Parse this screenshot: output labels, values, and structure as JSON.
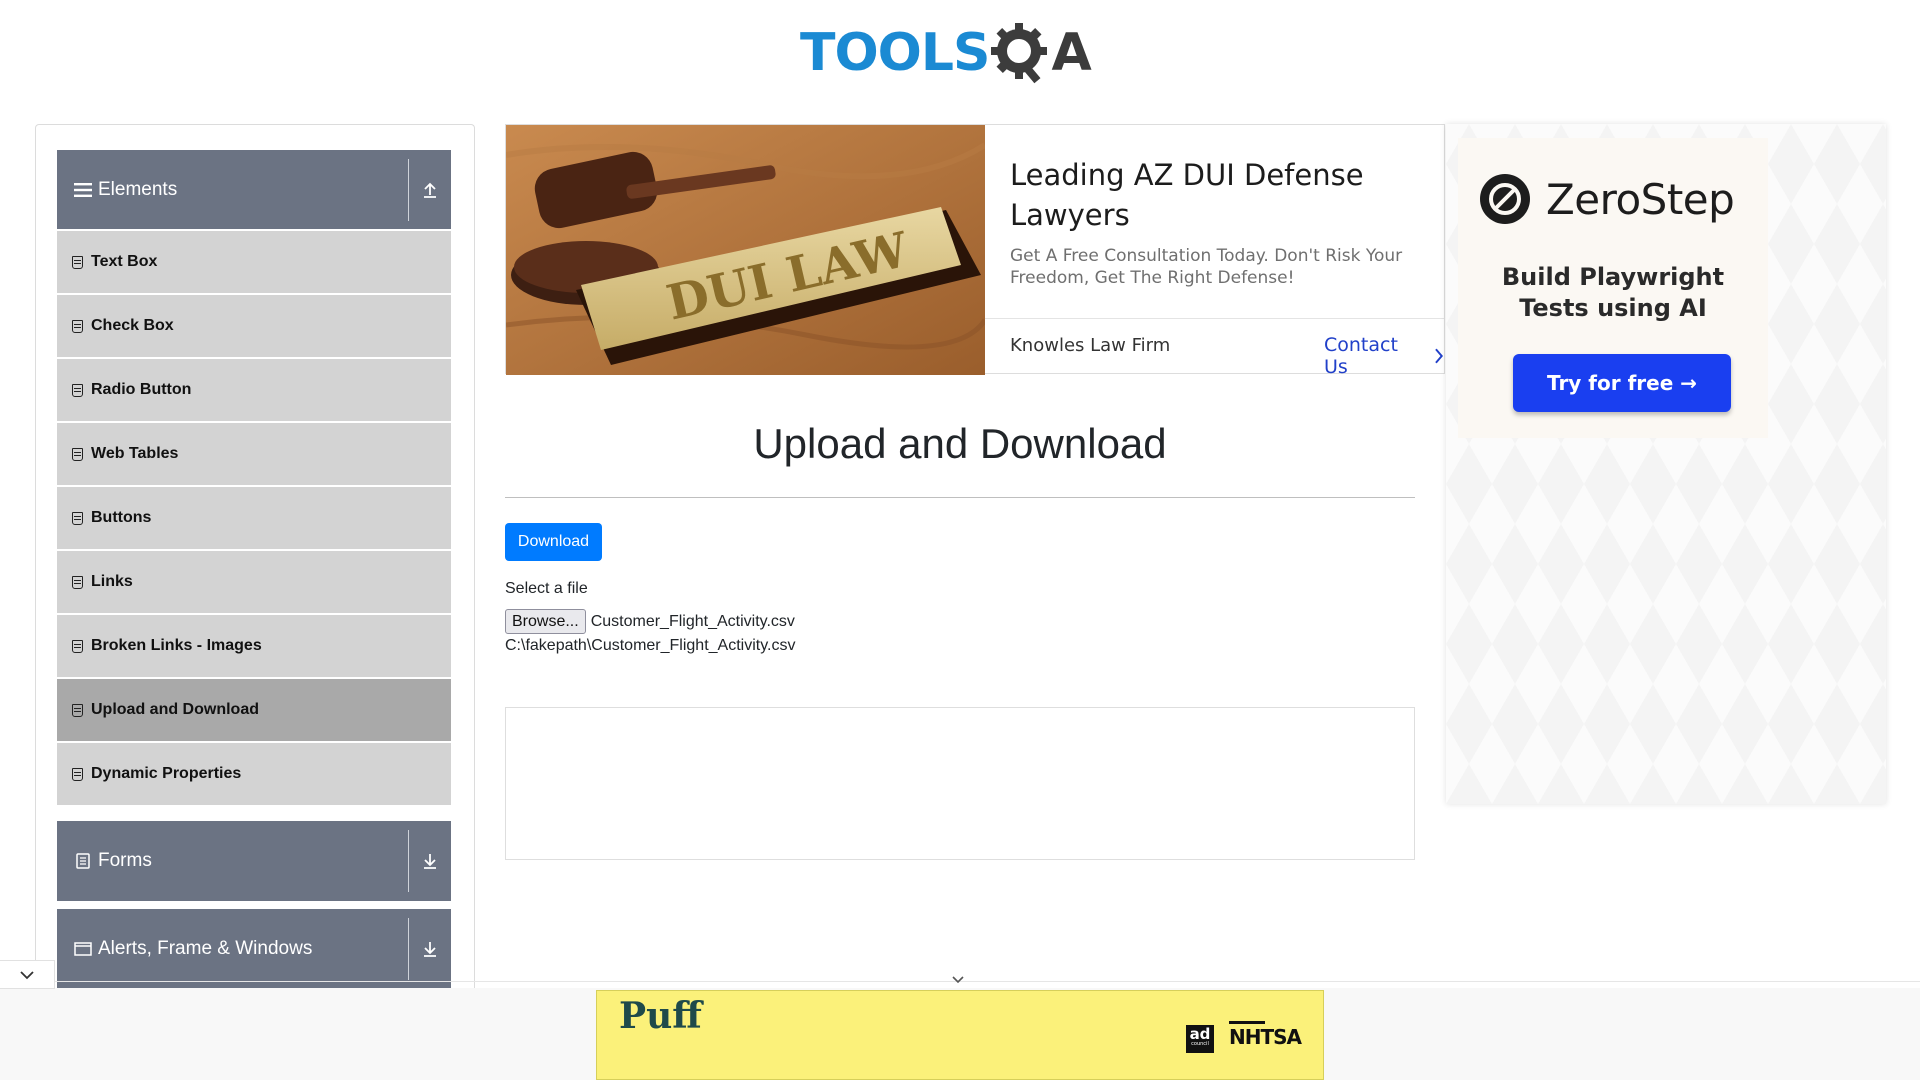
{
  "header": {
    "logo_tools": "TOOLS",
    "logo_qa": "A"
  },
  "sidebar": {
    "groups": [
      {
        "label": "Elements",
        "icon": "hamburger-icon",
        "arrow": "collapse-up-icon"
      },
      {
        "label": "Forms",
        "icon": "form-icon",
        "arrow": "expand-down-icon"
      },
      {
        "label": "Alerts, Frame & Windows",
        "icon": "window-icon",
        "arrow": "expand-down-icon"
      }
    ],
    "items": [
      {
        "label": "Text Box"
      },
      {
        "label": "Check Box"
      },
      {
        "label": "Radio Button"
      },
      {
        "label": "Web Tables"
      },
      {
        "label": "Buttons"
      },
      {
        "label": "Links"
      },
      {
        "label": "Broken Links - Images"
      },
      {
        "label": "Upload and Download",
        "active": true
      },
      {
        "label": "Dynamic Properties"
      }
    ]
  },
  "ad_top": {
    "image_text": "DUI LAW",
    "title": "Leading AZ DUI Defense Lawyers",
    "description": "Get A Free Consultation Today. Don't Risk Your Freedom, Get The Right Defense!",
    "firm": "Knowles Law Firm",
    "cta": "Contact Us"
  },
  "main": {
    "title": "Upload and Download",
    "download_label": "Download",
    "select_label": "Select a file",
    "browse_label": "Browse...",
    "file_name": "Customer_Flight_Activity.csv",
    "uploaded_path": "C:\\fakepath\\Customer_Flight_Activity.csv"
  },
  "ad_right": {
    "brand": "ZeroStep",
    "subtitle_line1": "Build Playwright",
    "subtitle_line2": "Tests using AI",
    "cta": "Try for free →"
  },
  "ad_bottom": {
    "brand": "Puff",
    "sponsor1": "ad",
    "sponsor1_sub": "council",
    "sponsor2": "NHTSA"
  },
  "colors": {
    "primary": "#007bff",
    "sidebar_header": "#6b7383",
    "menu_item": "#d3d3d3",
    "menu_item_active": "#a9a9a9",
    "logo_blue": "#1b8ad3"
  }
}
